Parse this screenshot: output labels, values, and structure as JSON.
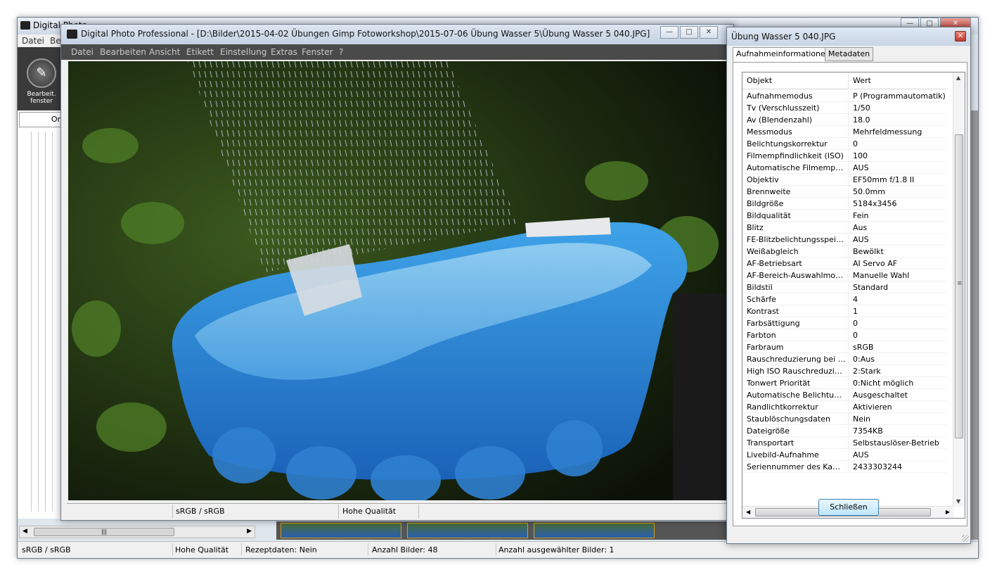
{
  "bg_window": {
    "title": "Digital Photo Professional",
    "menu": [
      "Datei",
      "Be"
    ],
    "edit_tool_label_1": "Bearbeit.",
    "edit_tool_label_2": "fenster",
    "folder_tab": "Or",
    "status": {
      "color_space": "sRGB / sRGB",
      "quality": "Hohe Qualität",
      "recipe": "Rezeptdaten: Nein",
      "count": "Anzahl Bilder: 48",
      "selected": "Anzahl ausgewählter Bilder: 1"
    }
  },
  "editor": {
    "title": "Digital Photo Professional - [D:\\Bilder\\2015-04-02 Übungen  Gimp Fotoworkshop\\2015-07-06 Übung Wasser 5\\Übung Wasser 5 040.JPG]",
    "menu": [
      "Datei",
      "Bearbeiten",
      "Ansicht",
      "Etikett",
      "Einstellung",
      "Extras",
      "Fenster",
      "?"
    ],
    "status": {
      "color_space": "sRGB / sRGB",
      "quality": "Hohe Qualität"
    }
  },
  "info_dialog": {
    "title": "Übung Wasser 5 040.JPG",
    "tabs": [
      "Aufnahmeinformationen",
      "Metadaten"
    ],
    "columns": [
      "Objekt",
      "Wert"
    ],
    "rows": [
      [
        "Aufnahmemodus",
        "P (Programmautomatik)"
      ],
      [
        "Tv (Verschlusszeit)",
        "1/50"
      ],
      [
        "Av (Blendenzahl)",
        "18.0"
      ],
      [
        "Messmodus",
        "Mehrfeldmessung"
      ],
      [
        "Belichtungskorrektur",
        "0"
      ],
      [
        "Filmempfindlichkeit (ISO)",
        "100"
      ],
      [
        "Automatische Filmempfindli...",
        "AUS"
      ],
      [
        "Objektiv",
        "EF50mm f/1.8 II"
      ],
      [
        "Brennweite",
        "50.0mm"
      ],
      [
        "Bildgröße",
        "5184x3456"
      ],
      [
        "Bildqualität",
        "Fein"
      ],
      [
        "Blitz",
        "Aus"
      ],
      [
        "FE-Blitzbelichtungsspeicher...",
        "AUS"
      ],
      [
        "Weißabgleich",
        "Bewölkt"
      ],
      [
        "AF-Betriebsart",
        "AI Servo AF"
      ],
      [
        "AF-Bereich-Auswahlmodus",
        "Manuelle  Wahl"
      ],
      [
        "Bildstil",
        "Standard"
      ],
      [
        "Schärfe",
        "4"
      ],
      [
        "Kontrast",
        "1"
      ],
      [
        "Farbsättigung",
        "0"
      ],
      [
        "Farbton",
        "0"
      ],
      [
        "Farbraum",
        "sRGB"
      ],
      [
        "Rauschreduzierung bei Lan...",
        "0:Aus"
      ],
      [
        "High ISO Rauschreduzierung",
        "2:Stark"
      ],
      [
        "Tonwert Priorität",
        "0:Nicht möglich"
      ],
      [
        "Automatische Belichtungso...",
        "Ausgeschaltet"
      ],
      [
        "Randlichtkorrektur",
        "Aktivieren"
      ],
      [
        "Staublöschungsdaten",
        "Nein"
      ],
      [
        "Dateigröße",
        "7354KB"
      ],
      [
        "Transportart",
        "Selbstauslöser-Betrieb"
      ],
      [
        "Livebild-Aufnahme",
        "AUS"
      ],
      [
        "Seriennummer des Kamera...",
        "2433303244"
      ]
    ],
    "close_button": "Schließen"
  }
}
